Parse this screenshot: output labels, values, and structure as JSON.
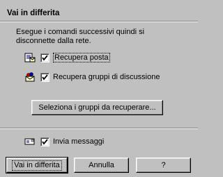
{
  "dialog": {
    "title": "Vai in differita",
    "description": "Esegue i comandi successivi quindi si disconnette dalla rete."
  },
  "options": [
    {
      "icon": "document-mail-icon",
      "label": "Recupera posta",
      "checked": true
    },
    {
      "icon": "newsgroup-icon",
      "label": "Recupera gruppi di discussione",
      "checked": true
    }
  ],
  "select_groups_button": "Seleziona i gruppi  da recuperare...",
  "send": {
    "icon": "envelope-icon",
    "label": "Invia messaggi",
    "checked": true
  },
  "buttons": {
    "ok": "Vai in differita",
    "cancel": "Annulla",
    "help": "?"
  }
}
